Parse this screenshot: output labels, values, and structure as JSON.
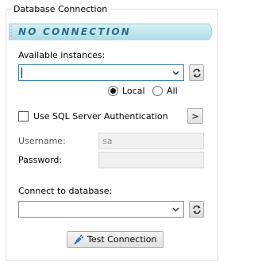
{
  "group": {
    "title": "Database Connection"
  },
  "status": {
    "text": "NO CONNECTION"
  },
  "instances": {
    "label": "Available instances:",
    "value": "",
    "local_label": "Local",
    "all_label": "All",
    "selected": "Local"
  },
  "auth": {
    "checkbox_label": "Use SQL Server Authentication",
    "checked": false,
    "expand_label": ">",
    "username_label": "Username:",
    "username_value": "sa",
    "password_label": "Password:",
    "password_value": ""
  },
  "database": {
    "label": "Connect to database:",
    "value": ""
  },
  "actions": {
    "test_label": "Test Connection"
  },
  "icons": {
    "refresh_instances": "refresh-icon",
    "refresh_databases": "refresh-icon",
    "dropdown": "chevron-down-icon",
    "test": "database-plug-icon"
  },
  "colors": {
    "banner_start": "#b6e3ea",
    "banner_end": "#d8f1f4",
    "banner_text": "#2b6c8a",
    "focus_border": "#3c7fb1"
  }
}
